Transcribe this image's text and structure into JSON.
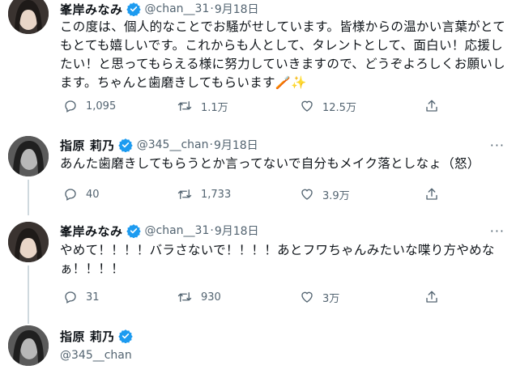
{
  "tweets": [
    {
      "name": "峯岸みなみ",
      "handle": "@chan__31",
      "dot": "·",
      "date": "9月18日",
      "text": "この度は、個人的なことでお騒がせしています。皆様からの温かい言葉がとてもとても嬉しいです。これからも人として、タレントとして、面白い！応援したい！と思ってもらえる様に努力していきますので、どうぞよろしくお願いします。ちゃんと歯磨きしてもらいます🪥✨",
      "replies": "1,095",
      "retweets": "1.1万",
      "likes": "12.5万"
    },
    {
      "name": "指原 莉乃",
      "handle": "@345__chan",
      "dot": "·",
      "date": "9月18日",
      "text": "あんた歯磨きしてもらうとか言ってないで自分もメイク落としなょ（怒）",
      "replies": "40",
      "retweets": "1,733",
      "likes": "3.9万"
    },
    {
      "name": "峯岸みなみ",
      "handle": "@chan__31",
      "dot": "·",
      "date": "9月18日",
      "text": "やめて！！！！バラさないで！！！！あとフワちゃんみたいな喋り方やめなぁ！！！！",
      "replies": "31",
      "retweets": "930",
      "likes": "3万"
    },
    {
      "name": "指原 莉乃",
      "handle": "@345__chan"
    }
  ],
  "more_label": "···",
  "colors": {
    "verified": "#1d9bf0",
    "muted": "#536471",
    "thread": "#cfd9de"
  }
}
